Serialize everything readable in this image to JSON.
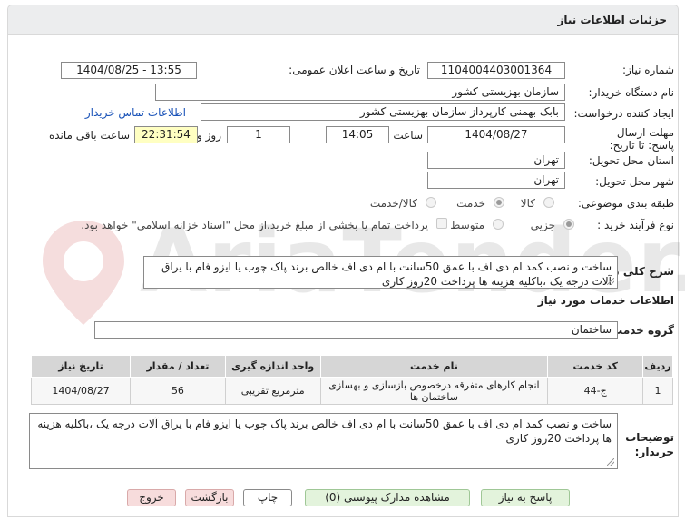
{
  "panel": {
    "title": "جزئیات اطلاعات نیاز"
  },
  "watermark": {
    "text": "AriaTender.net"
  },
  "fields": {
    "need_number_label": "شماره نیاز:",
    "need_number": "1104004403001364",
    "announce_label": "تاریخ و ساعت اعلان عمومی:",
    "announce_value": "1404/08/25 - 13:55",
    "buyer_label": "نام دستگاه خریدار:",
    "buyer_value": "سازمان بهزیستی کشور",
    "creator_label": "ایجاد کننده درخواست:",
    "creator_value": "بابک بهمنی کارپرداز سازمان بهزیستی کشور",
    "contact_link": "اطلاعات تماس خریدار",
    "deadline_label": "مهلت ارسال پاسخ: تا تاریخ:",
    "deadline_date": "1404/08/27",
    "time_label": "ساعت",
    "deadline_time": "14:05",
    "day_label": "روز و",
    "days": "1",
    "remaining": "22:31:54",
    "remaining_label": "ساعت باقی مانده",
    "province_label": "استان محل تحویل:",
    "province_value": "تهران",
    "city_label": "شهر محل تحویل:",
    "city_value": "تهران",
    "category_label": "طبقه بندی موضوعی:",
    "cat_goods": "کالا",
    "cat_service": "خدمت",
    "cat_goods_service": "کالا/خدمت",
    "process_label": "نوع فرآیند خرید :",
    "proc_minor": "جزیی",
    "proc_medium": "متوسط",
    "payment_note": "پرداخت تمام یا بخشی از مبلغ خرید،از محل \"اسناد خزانه اسلامی\" خواهد بود."
  },
  "summary": {
    "label": "شرح کلی نیاز:",
    "text": "ساخت و نصب کمد ام دی اف با عمق 50سانت با ام دی اف خالص برند پاک چوب یا ایزو فام با یراق آلات درجه یک ،باکلیه هزینه ها پرداخت 20روز کاری"
  },
  "services": {
    "section_title": "اطلاعات خدمات مورد نیاز",
    "group_label": "گروه خدمت:",
    "group_value": "ساختمان",
    "columns": [
      "ردیف",
      "کد خدمت",
      "نام خدمت",
      "واحد اندازه گیری",
      "تعداد / مقدار",
      "تاریخ نیاز"
    ],
    "rows": [
      {
        "row": "1",
        "code": "ج-44",
        "name": "انجام کارهای متفرقه درخصوص بازسازی و بهسازی ساختمان ها",
        "unit": "مترمربع تقریبی",
        "qty": "56",
        "date": "1404/08/27"
      }
    ]
  },
  "buyer_notes": {
    "label": "توضیحات خریدار:",
    "text": "ساخت و نصب کمد ام دی اف با عمق 50سانت با ام دی اف خالص برند پاک چوب یا ایزو فام با یراق آلات درجه یک ،باکلیه هزینه ها پرداخت 20روز کاری"
  },
  "buttons": {
    "respond": "پاسخ به نیاز",
    "attachments": "مشاهده مدارک پیوستی (0)",
    "print": "چاپ",
    "back": "بازگشت",
    "exit": "خروج"
  }
}
